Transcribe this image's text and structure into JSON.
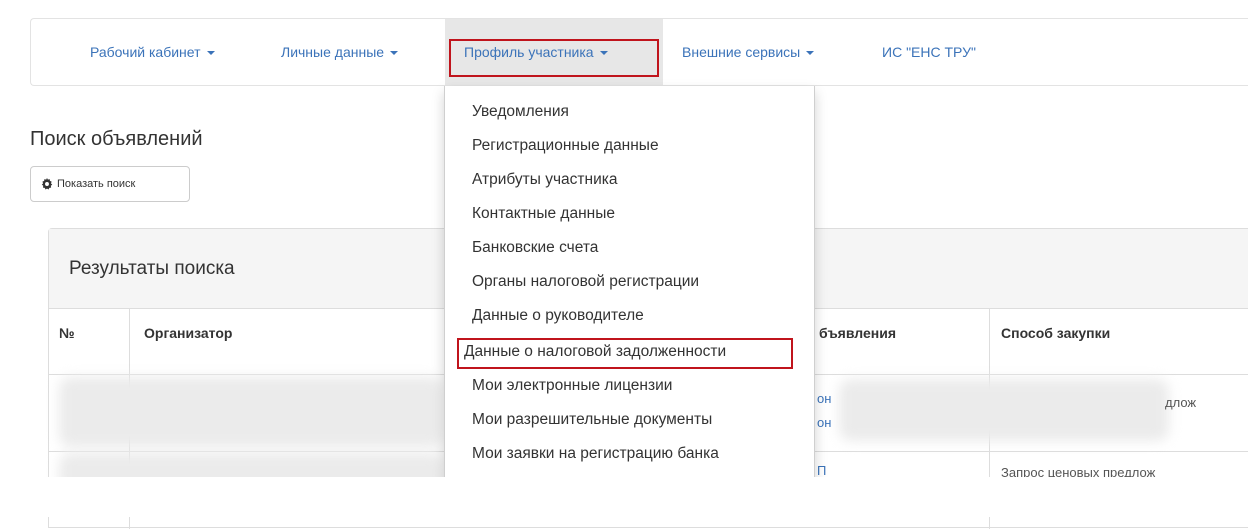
{
  "navbar": {
    "items": [
      {
        "label": "Рабочий кабинет"
      },
      {
        "label": "Личные данные"
      },
      {
        "label": "Профиль участника"
      },
      {
        "label": "Внешние сервисы"
      },
      {
        "label": "ИС \"ЕНС ТРУ\""
      }
    ],
    "active_item": "Профиль участника"
  },
  "page": {
    "title": "Поиск объявлений",
    "show_search_label": "Показать поиск"
  },
  "results": {
    "title": "Результаты поиска",
    "columns": [
      "№",
      "Организатор",
      "бъявления",
      "Способ закупки"
    ],
    "row1": {
      "link_top": "он",
      "link_bottom": "он",
      "method": "длож"
    },
    "row2": {
      "link": "П",
      "method": "Запрос ценовых предлож"
    }
  },
  "dropdown": {
    "items": [
      "Уведомления",
      "Регистрационные данные",
      "Атрибуты участника",
      "Контактные данные",
      "Банковские счета",
      "Органы налоговой регистрации",
      "Данные о руководителе",
      "Данные о налоговой задолженности",
      "Мои электронные лицензии",
      "Мои разрешительные документы",
      "Мои заявки на регистрацию банка"
    ],
    "highlighted_item": "Данные о налоговой задолженности"
  },
  "colors": {
    "link": "#3b73b9",
    "highlight_border": "#c0141c",
    "active_tab_bg": "#e7e7e7"
  }
}
